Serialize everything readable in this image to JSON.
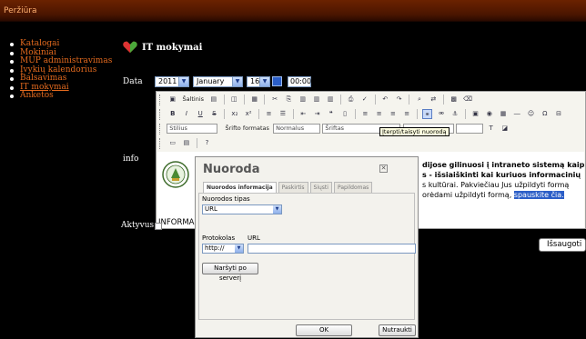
{
  "window": {
    "title": "Peržiūra"
  },
  "sidebar": {
    "items": [
      {
        "label": "Katalogai"
      },
      {
        "label": "Mokiniai"
      },
      {
        "label": "MUP administravimas"
      },
      {
        "label": "Įvykių kalendorius"
      },
      {
        "label": "Balsavimas"
      },
      {
        "label": "IT mokymai",
        "active": true
      },
      {
        "label": "Anketos"
      }
    ]
  },
  "page": {
    "title": "IT mokymai"
  },
  "form": {
    "date_label": "Data",
    "year": "2011",
    "month": "January",
    "day": "16",
    "time": "00:00",
    "info_label": "info",
    "active_label": "Aktyvus",
    "save_label": "Išsaugoti"
  },
  "editor": {
    "source_label": "Šaltinis",
    "style_select": "Stilius",
    "format_label": "Šrifto formatas",
    "format_value": "Normalus",
    "font_select": "Šriftas",
    "tooltip": "Įterpti/taisyti nuorodą"
  },
  "content": {
    "lines": [
      "dijose gilinuosi į intraneto sistemą kaip",
      "s - išsiaiškinti kai kuriuos informacinių",
      "s kultūrai. Pakviečiau Jus užpildyti formą",
      "orėdami užpildyti formą,"
    ],
    "link_text": "spauskite čia.",
    "logo_caption": "INFORMA"
  },
  "dialog": {
    "title": "Nuoroda",
    "tabs": [
      "Nuorodos informacija",
      "Paskirtis",
      "Siųsti",
      "Papildomas"
    ],
    "link_type_label": "Nuorodos tipas",
    "link_type_value": "URL",
    "protocol_label": "Protokolas",
    "protocol_value": "http://",
    "url_label": "URL",
    "url_value": "",
    "browse_label": "Naršyti po serverį",
    "ok_label": "OK",
    "cancel_label": "Nutraukti"
  },
  "colors": {
    "menu_link": "#e46a1e",
    "titlebar": "#4a1500",
    "selection": "#2b5ec7"
  }
}
